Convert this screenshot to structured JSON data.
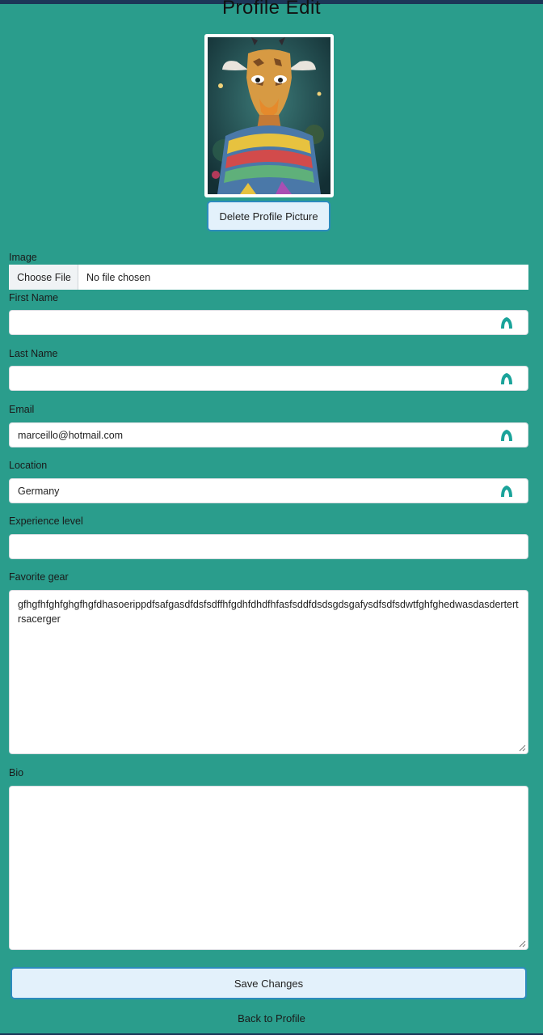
{
  "page": {
    "title": "Profile Edit"
  },
  "avatar": {
    "alt": "giraffe wearing a colorful scarf"
  },
  "buttons": {
    "delete_picture": "Delete Profile Picture",
    "save": "Save Changes",
    "back": "Back to Profile"
  },
  "image_field": {
    "label": "Image",
    "button": "Choose File",
    "status": "No file chosen"
  },
  "fields": {
    "first_name": {
      "label": "First Name",
      "value": ""
    },
    "last_name": {
      "label": "Last Name",
      "value": ""
    },
    "email": {
      "label": "Email",
      "value": "marceillo@hotmail.com"
    },
    "location": {
      "label": "Location",
      "value": "Germany"
    },
    "experience": {
      "label": "Experience level",
      "value": ""
    },
    "favorite_gear": {
      "label": "Favorite gear",
      "value": "gfhgfhfghfghgfhgfdhasoerippdfsafgasdfdsfsdffhfgdhfdhdfhfasfsddfdsdsgdsgafysdfsdfsdwtfghfghedwasdasdertertrsacerger"
    },
    "bio": {
      "label": "Bio",
      "value": ""
    }
  },
  "icons": {
    "autofill": "autofill-icon",
    "resize": "resize-grip-icon"
  },
  "colors": {
    "background": "#2a9d8c",
    "button_bg": "#e3f1fb",
    "button_border": "#2c8bbd",
    "autofill_icon": "#1aa39a"
  }
}
